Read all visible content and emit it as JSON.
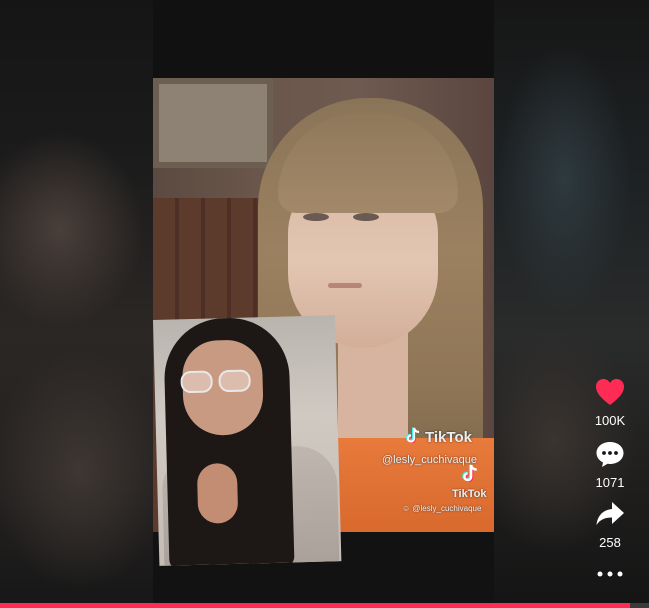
{
  "overlay": {
    "brand": "TikTok",
    "handle": "@lesly_cuchivaque",
    "brand_small": "TikTok",
    "handle_small": "@lesly_cuchivaque"
  },
  "actions": {
    "likes": "100K",
    "comments": "1071",
    "shares": "258"
  },
  "icons": [
    "heart-icon",
    "comment-icon",
    "share-icon",
    "more-icon",
    "tiktok-logo-icon"
  ],
  "colors": {
    "accent": "#fe2c55",
    "like": "#fe2c55"
  },
  "progress": {
    "fraction": 0.97
  }
}
